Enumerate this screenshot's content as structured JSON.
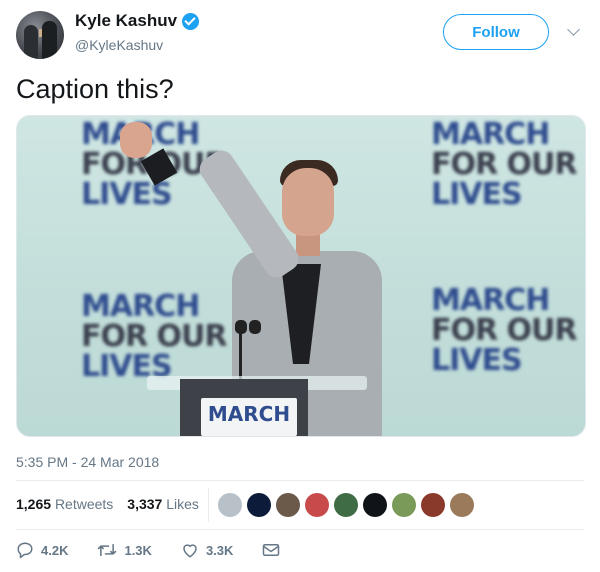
{
  "author": {
    "display_name": "Kyle Kashuv",
    "handle": "@KyleKashuv",
    "verified": true
  },
  "follow_label": "Follow",
  "tweet_text": "Caption this?",
  "media": {
    "sign_text": [
      "MARCH",
      "FOR OUR",
      "LIVES"
    ],
    "podium_text": "MARCH"
  },
  "timestamp": "5:35 PM - 24 Mar 2018",
  "stats": {
    "retweets_count": "1,265",
    "retweets_label": "Retweets",
    "likes_count": "3,337",
    "likes_label": "Likes"
  },
  "likers_colors": [
    "#b8c0c8",
    "#0d1b3a",
    "#6b5a4a",
    "#c94a4a",
    "#3f6b45",
    "#101418",
    "#7a9a5a",
    "#8a3a2a",
    "#9a7a5a"
  ],
  "actions": {
    "reply_count": "4.2K",
    "retweet_count": "1.3K",
    "like_count": "3.3K"
  },
  "colors": {
    "accent": "#1da1f2",
    "secondary_text": "#657786"
  }
}
